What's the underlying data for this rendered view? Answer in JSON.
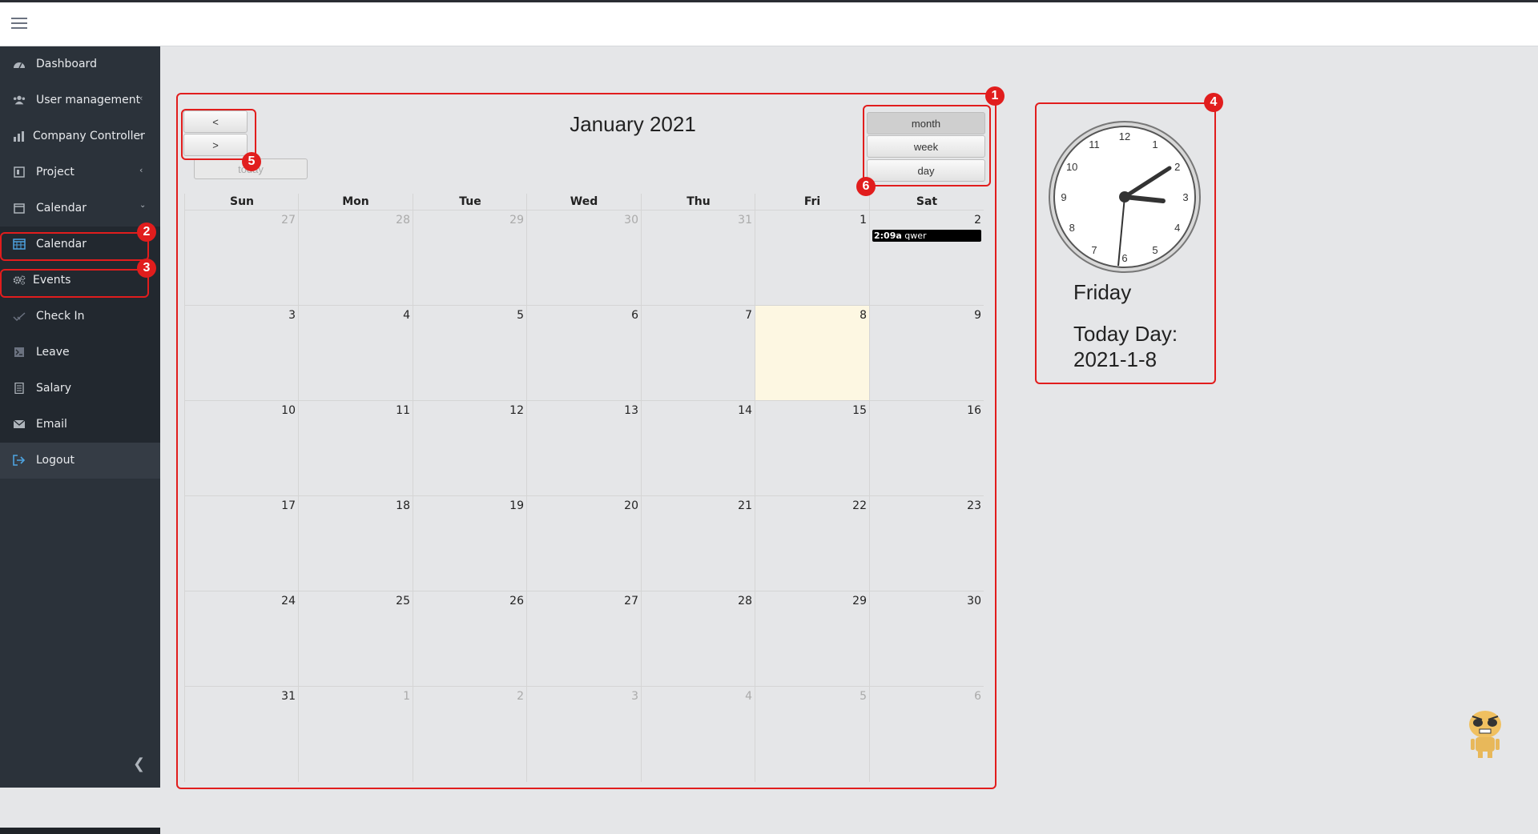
{
  "sidebar": {
    "items": [
      {
        "label": "Dashboard",
        "icon": "dashboard-icon",
        "has_chevron": false
      },
      {
        "label": "User management",
        "icon": "users-icon",
        "has_chevron": true
      },
      {
        "label": "Company Controller",
        "icon": "chart-icon",
        "has_chevron": true
      },
      {
        "label": "Project",
        "icon": "project-icon",
        "has_chevron": true
      },
      {
        "label": "Calendar",
        "icon": "calendar-icon",
        "has_chevron": true
      },
      {
        "label": "Calendar",
        "icon": "calendar-grid-icon",
        "has_chevron": false
      },
      {
        "label": "Events",
        "icon": "gears-icon",
        "has_chevron": false
      },
      {
        "label": "Check In",
        "icon": "check-icon",
        "has_chevron": false
      },
      {
        "label": "Leave",
        "icon": "terminal-icon",
        "has_chevron": false
      },
      {
        "label": "Salary",
        "icon": "document-icon",
        "has_chevron": false
      },
      {
        "label": "Email",
        "icon": "envelope-icon",
        "has_chevron": false
      },
      {
        "label": "Logout",
        "icon": "logout-icon",
        "has_chevron": false
      }
    ]
  },
  "calendar": {
    "title": "January 2021",
    "prev_label": "<",
    "next_label": ">",
    "today_label": "today",
    "views": [
      "month",
      "week",
      "day"
    ],
    "active_view": "month",
    "day_headers": [
      "Sun",
      "Mon",
      "Tue",
      "Wed",
      "Thu",
      "Fri",
      "Sat"
    ],
    "weeks": [
      [
        "27",
        "28",
        "29",
        "30",
        "31",
        "1",
        "2"
      ],
      [
        "3",
        "4",
        "5",
        "6",
        "7",
        "8",
        "9"
      ],
      [
        "10",
        "11",
        "12",
        "13",
        "14",
        "15",
        "16"
      ],
      [
        "17",
        "18",
        "19",
        "20",
        "21",
        "22",
        "23"
      ],
      [
        "24",
        "25",
        "26",
        "27",
        "28",
        "29",
        "30"
      ],
      [
        "31",
        "1",
        "2",
        "3",
        "4",
        "5",
        "6"
      ]
    ],
    "today_date": "8",
    "event": {
      "time": "2:09a",
      "title": "qwer",
      "day": "2"
    }
  },
  "clock": {
    "numbers": [
      "12",
      "1",
      "2",
      "3",
      "4",
      "5",
      "6",
      "7",
      "8",
      "9",
      "10",
      "11"
    ],
    "day_name": "Friday",
    "today_label": "Today Day:",
    "today_value": "2021-1-8"
  },
  "annotations": [
    "1",
    "2",
    "3",
    "4",
    "5",
    "6"
  ],
  "colors": {
    "sidebar_bg": "#2b323a",
    "annotation_red": "#e11d1d",
    "today_bg": "#fdf7e2",
    "event_bg": "#000000"
  }
}
